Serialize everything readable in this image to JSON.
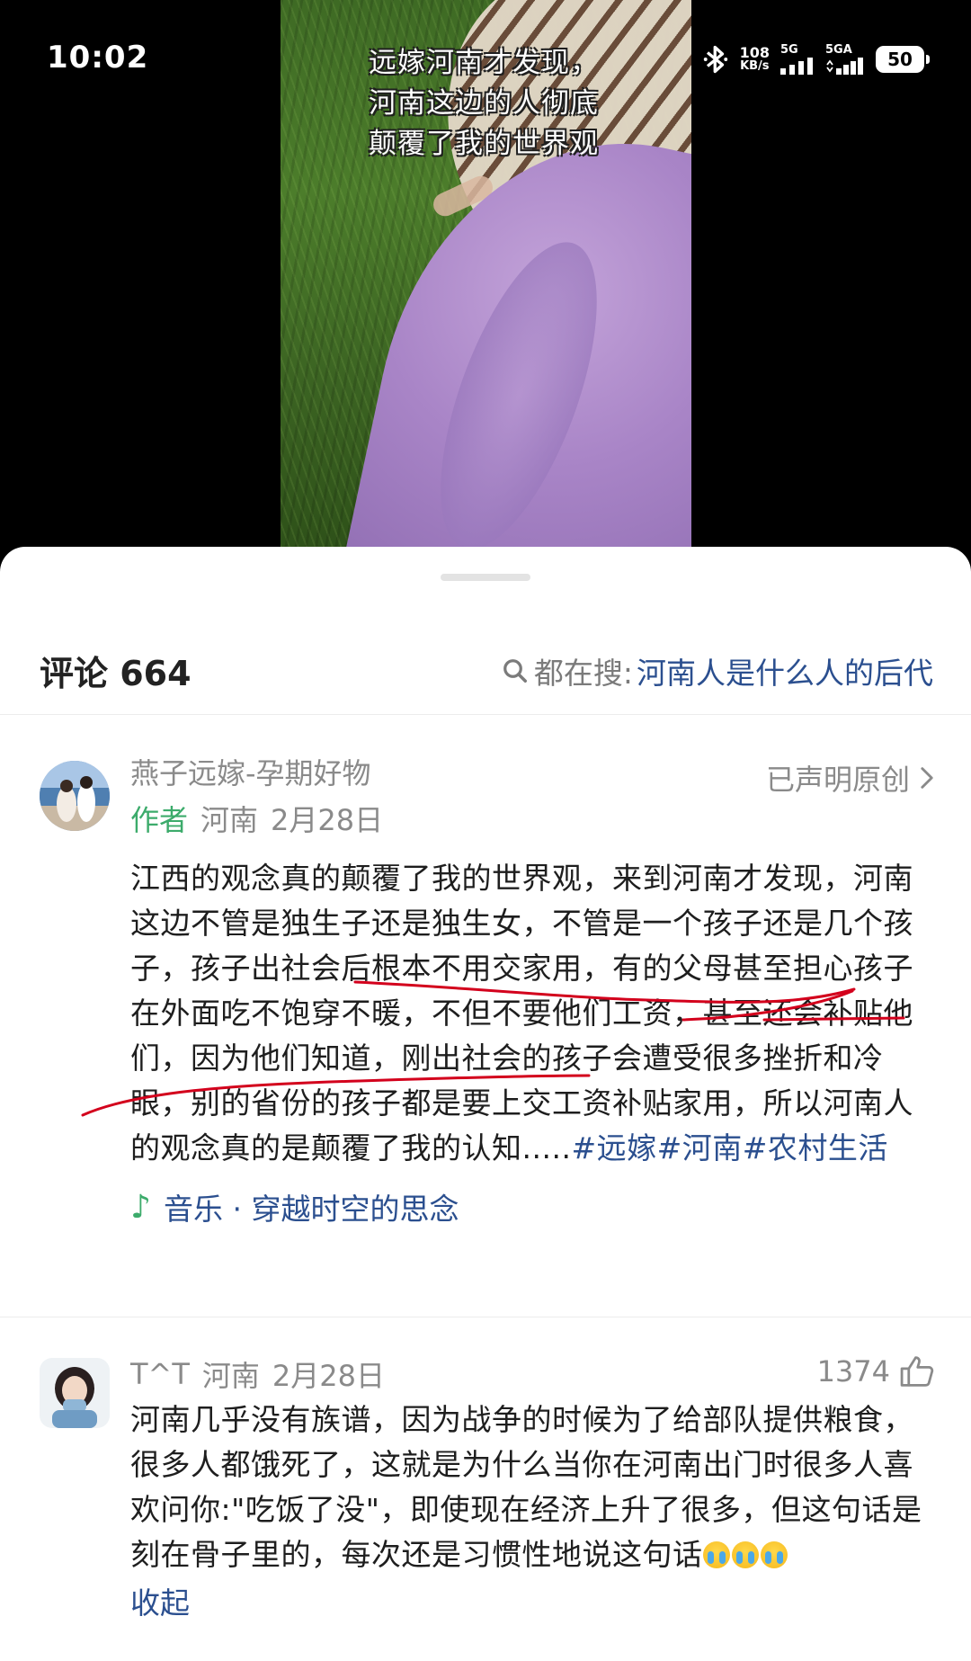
{
  "status_bar": {
    "time": "10:02",
    "net_speed_value": "108",
    "net_speed_unit": "KB/s",
    "signal1_label": "5G",
    "signal2_label": "5GA",
    "battery": "50"
  },
  "video": {
    "caption_lines": [
      "远嫁河南才发现，",
      "河南这边的人彻底",
      "颠覆了我的世界观"
    ]
  },
  "comments_header": {
    "title": "评论 664",
    "search_prefix": "都在搜:",
    "search_keyword": "河南人是什么人的后代"
  },
  "comments": [
    {
      "username": "燕子远嫁-孕期好物",
      "tag": "作者",
      "location": "河南",
      "date": "2月28日",
      "claim": "已声明原创",
      "text": "江西的观念真的颠覆了我的世界观，来到河南才发现，河南这边不管是独生子还是独生女，不管是一个孩子还是几个孩子，孩子出社会后根本不用交家用，有的父母甚至担心孩子在外面吃不饱穿不暖，不但不要他们工资，甚至还会补贴他们，因为他们知道，刚出社会的孩子会遭受很多挫折和冷眼，别的省份的孩子都是要上交工资补贴家用，所以河南人的观念真的是颠覆了我的认知.....",
      "hashtags": "#远嫁#河南#农村生活",
      "music": "音乐 · 穿越时空的思念"
    },
    {
      "username": "T^T",
      "location": "河南",
      "date": "2月28日",
      "likes": "1374",
      "text": "河南几乎没有族谱，因为战争的时候为了给部队提供粮食，很多人都饿死了，这就是为什么当你在河南出门时很多人喜欢问你:\"吃饭了没\"，即使现在经济上升了很多，但这句话是刻在骨子里的，每次还是习惯性地说这句话",
      "collapse": "收起"
    }
  ],
  "colors": {
    "link_blue": "#2b4f8f",
    "author_green": "#3cab6b",
    "meta_gray": "#8a8a8a",
    "pen_red": "#d3001c"
  }
}
